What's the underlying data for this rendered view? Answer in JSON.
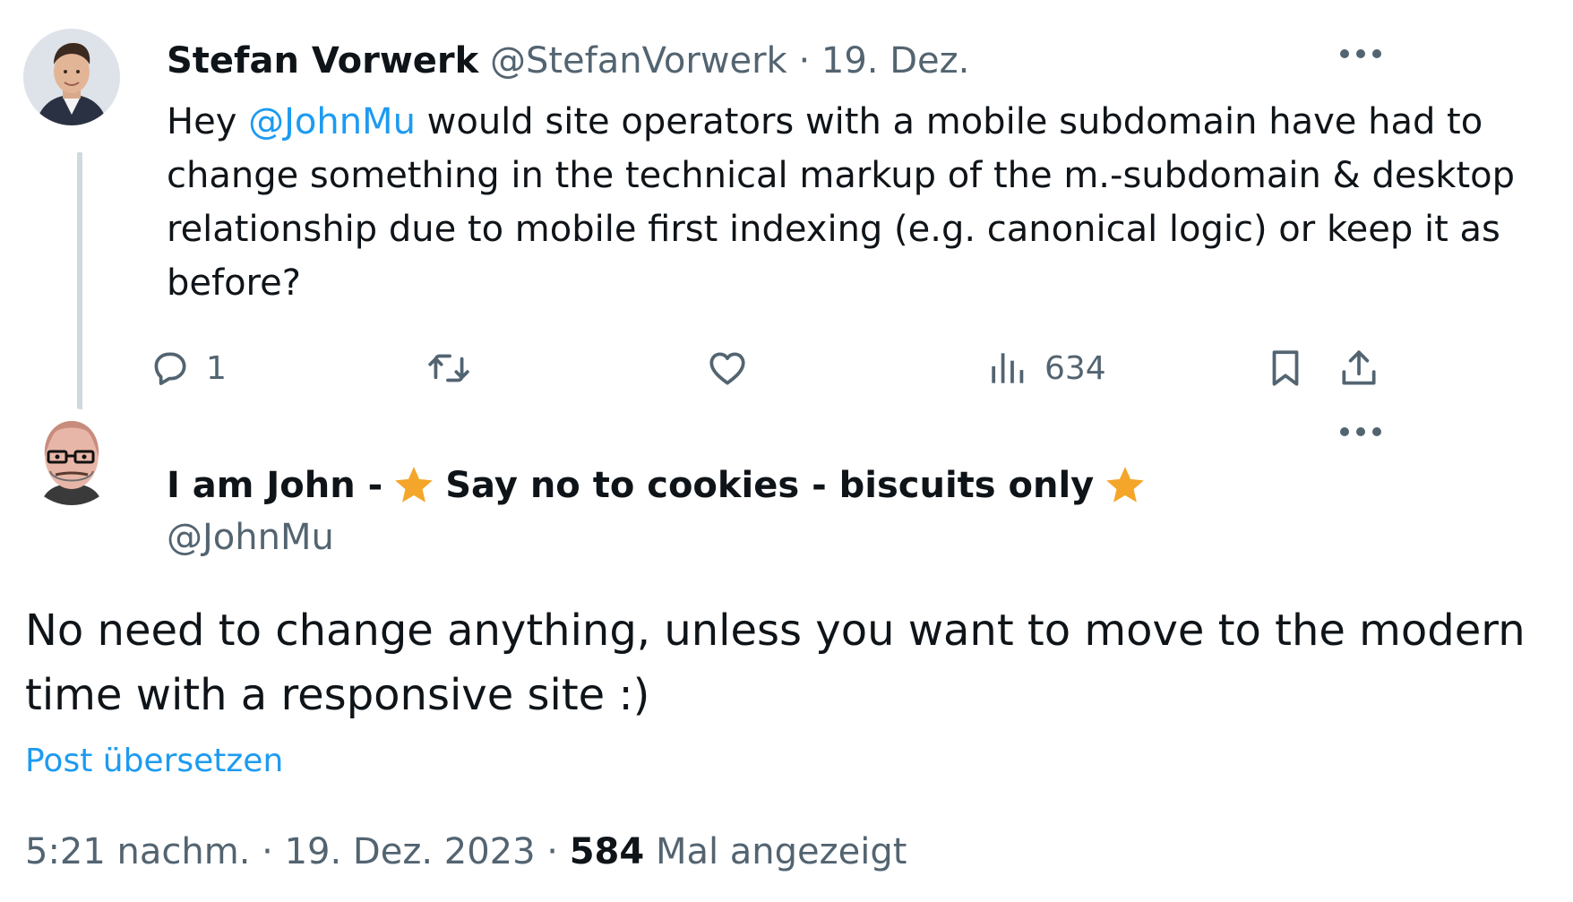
{
  "parent_tweet": {
    "author_name": "Stefan Vorwerk",
    "author_handle": "@StefanVorwerk",
    "separator": "·",
    "date": "19. Dez.",
    "text_prefix": "Hey ",
    "mention": "@JohnMu",
    "text_line1": " would site operators with a mobile subdomain have had to",
    "text_line2": "change something in the technical markup of the m.-subdomain & desktop",
    "text_line3": "relationship due to mobile first indexing (e.g. canonical logic) or keep it as",
    "text_line4": "before?",
    "actions": {
      "reply_count": "1",
      "views_count": "634"
    }
  },
  "reply_tweet": {
    "author_name_part1": "I am John -",
    "author_name_part2": "Say no to cookies - biscuits only",
    "author_handle": "@JohnMu",
    "text_line1": "No need to change anything, unless you want to move to the modern",
    "text_line2": "time with a responsive site :)",
    "translate_label": "Post übersetzen",
    "meta": {
      "time": "5:21 nachm.",
      "separator": "·",
      "date": "19. Dez. 2023",
      "views_count": "584",
      "views_label": "Mal angezeigt"
    }
  },
  "colors": {
    "text": "#0f1419",
    "secondary": "#536471",
    "link": "#1d9bf0",
    "thread_line": "#cfd9de",
    "star": "#f4a62a"
  },
  "icons": {
    "reply": "reply-bubble-icon",
    "retweet": "retweet-icon",
    "like": "heart-icon",
    "views": "bar-chart-icon",
    "bookmark": "bookmark-icon",
    "share": "share-icon",
    "more": "more-dots-icon",
    "star": "star-icon"
  }
}
